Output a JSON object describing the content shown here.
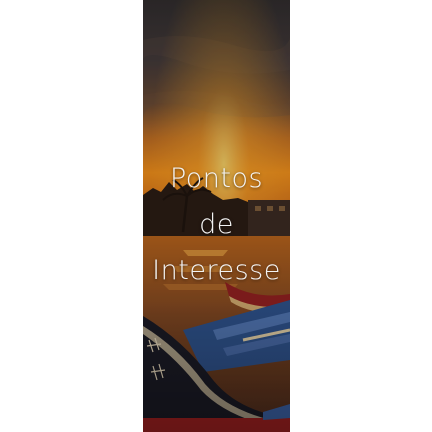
{
  "banner": {
    "title_line1": "Pontos",
    "title_line2": "de",
    "title_line3": "Interesse",
    "image_subject": "sunset over canal with moored wooden boats",
    "colors": {
      "title_text": "#f3f3f3",
      "sky_top": "#4a4040",
      "sky_glow": "#e07a18",
      "water": "#6a3a1c",
      "boat_blue": "#2d4f86",
      "boat_red": "#8b1f1f"
    }
  }
}
